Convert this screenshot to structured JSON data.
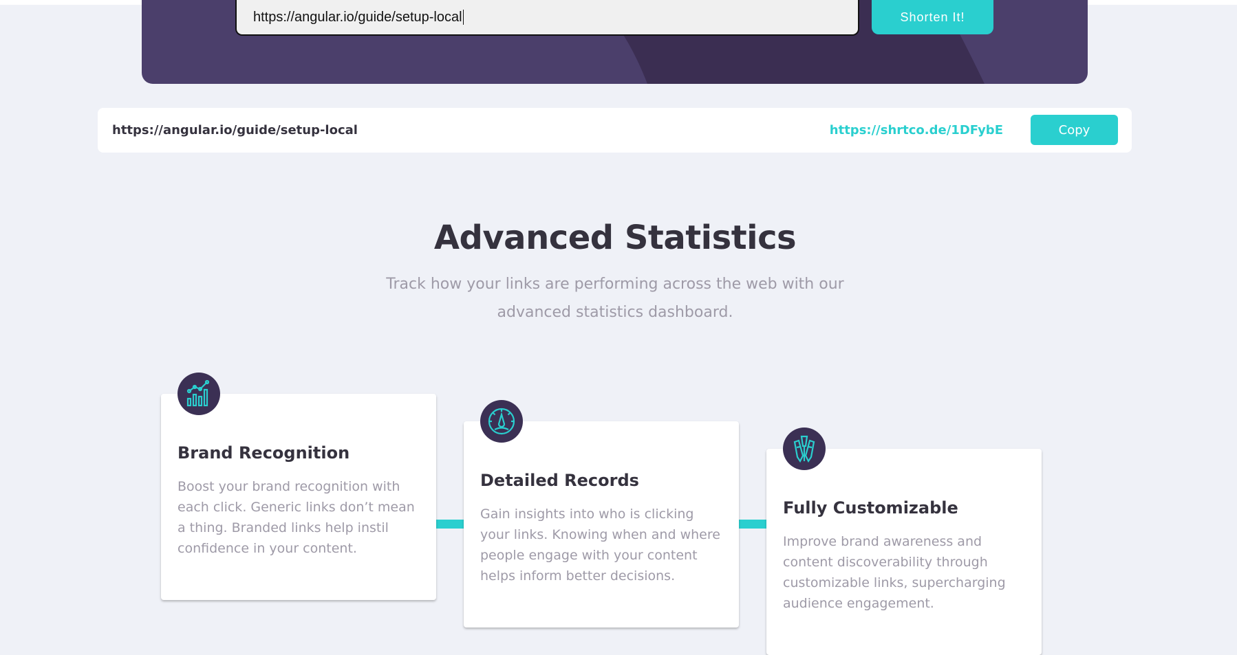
{
  "colors": {
    "page_bg": "#eff1f7",
    "hero_bg": "#4b3f6b",
    "accent": "#2acfcf",
    "dark_text": "#35323e",
    "muted_text": "#9e9aa7",
    "icon_bg": "#3b3054"
  },
  "shortener": {
    "input_value": "https://angular.io/guide/setup-local",
    "shorten_label": "Shorten It!"
  },
  "result": {
    "original_url": "https://angular.io/guide/setup-local",
    "short_url": "https://shrtco.de/1DFybE",
    "copy_label": "Copy"
  },
  "stats": {
    "title": "Advanced Statistics",
    "subtitle": "Track how your links are performing across the web with our advanced statistics dashboard.",
    "cards": [
      {
        "icon": "chart-icon",
        "title": "Brand Recognition",
        "text": "Boost your brand recognition with each click. Generic links don’t mean a thing. Branded links help instil confidence in your content."
      },
      {
        "icon": "gauge-icon",
        "title": "Detailed Records",
        "text": "Gain insights into who is clicking your links. Knowing when and where people engage with your content helps inform better decisions."
      },
      {
        "icon": "pens-icon",
        "title": "Fully Customizable",
        "text": "Improve brand awareness and content discoverability through customizable links, supercharging audience engagement."
      }
    ]
  }
}
